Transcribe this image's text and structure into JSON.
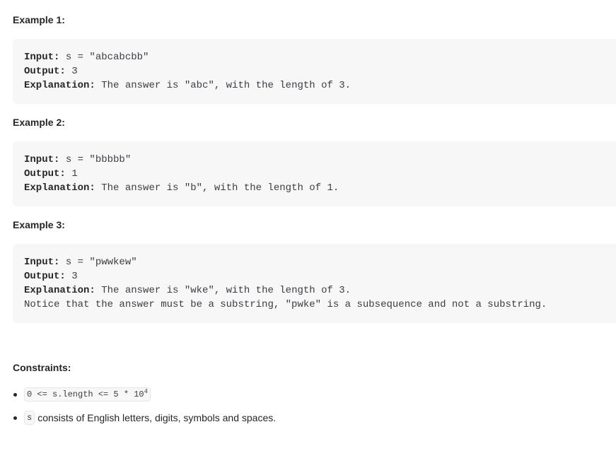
{
  "examples": [
    {
      "heading": "Example 1:",
      "input_label": "Input:",
      "input_value": " s = \"abcabcbb\"",
      "output_label": "Output:",
      "output_value": " 3",
      "explanation_label": "Explanation:",
      "explanation_value": " The answer is \"abc\", with the length of 3.",
      "extra_line": ""
    },
    {
      "heading": "Example 2:",
      "input_label": "Input:",
      "input_value": " s = \"bbbbb\"",
      "output_label": "Output:",
      "output_value": " 1",
      "explanation_label": "Explanation:",
      "explanation_value": " The answer is \"b\", with the length of 1.",
      "extra_line": ""
    },
    {
      "heading": "Example 3:",
      "input_label": "Input:",
      "input_value": " s = \"pwwkew\"",
      "output_label": "Output:",
      "output_value": " 3",
      "explanation_label": "Explanation:",
      "explanation_value": " The answer is \"wke\", with the length of 3.",
      "extra_line": "Notice that the answer must be a substring, \"pwke\" is a subsequence and not a substring."
    }
  ],
  "constraints": {
    "heading": "Constraints:",
    "items": [
      {
        "code": "0 <= s.length <= 5 * 10",
        "code_sup": "4",
        "text": ""
      },
      {
        "code": "s",
        "code_sup": "",
        "text": "consists of English letters, digits, symbols and spaces."
      }
    ]
  }
}
